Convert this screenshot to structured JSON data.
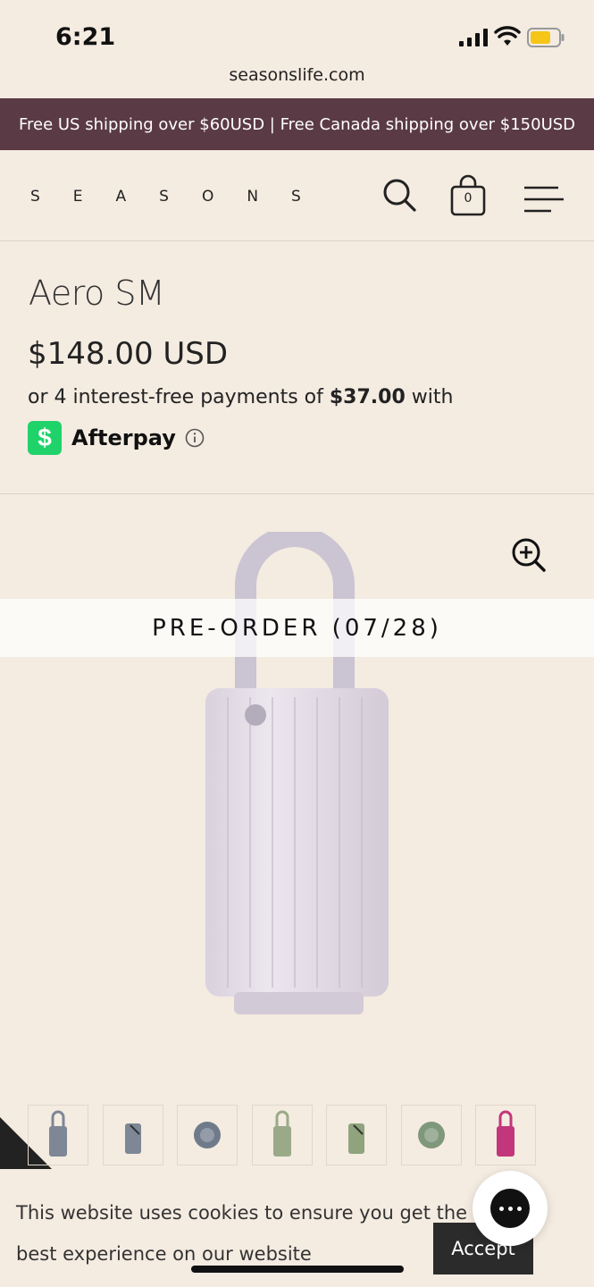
{
  "status_bar": {
    "time": "6:21",
    "url": "seasonslife.com"
  },
  "announcement": "Free US shipping over $60USD | Free Canada shipping over $150USD",
  "header": {
    "logo": "SEASONS",
    "cart_count": "0"
  },
  "product": {
    "title": "Aero SM",
    "price": "$148.00 USD",
    "afterpay_prefix": "or 4 interest-free payments of ",
    "afterpay_amount": "$37.00",
    "afterpay_suffix": " with",
    "afterpay_logo": "$",
    "afterpay_name": "Afterpay",
    "preorder": "PRE-ORDER (07/28)"
  },
  "thumbnails": [
    {
      "color": "#7d8795",
      "icon": "lantern-thumb"
    },
    {
      "color": "#7d8795",
      "icon": "lantern-side-thumb"
    },
    {
      "color": "#6f7b8a",
      "icon": "lantern-top-thumb"
    },
    {
      "color": "#9aaa88",
      "icon": "lantern-thumb"
    },
    {
      "color": "#8fa37c",
      "icon": "lantern-side-thumb"
    },
    {
      "color": "#7f977a",
      "icon": "lantern-top-thumb"
    },
    {
      "color": "#c2367b",
      "icon": "lantern-thumb"
    }
  ],
  "cookie": {
    "text": "This website uses cookies to ensure you get the best experience on our website",
    "accept": "Accept"
  },
  "colors": {
    "announce_bg": "#5a3a45",
    "background": "#f4ebe1",
    "afterpay_green": "#1fd36a",
    "product": "#e4dde8"
  }
}
